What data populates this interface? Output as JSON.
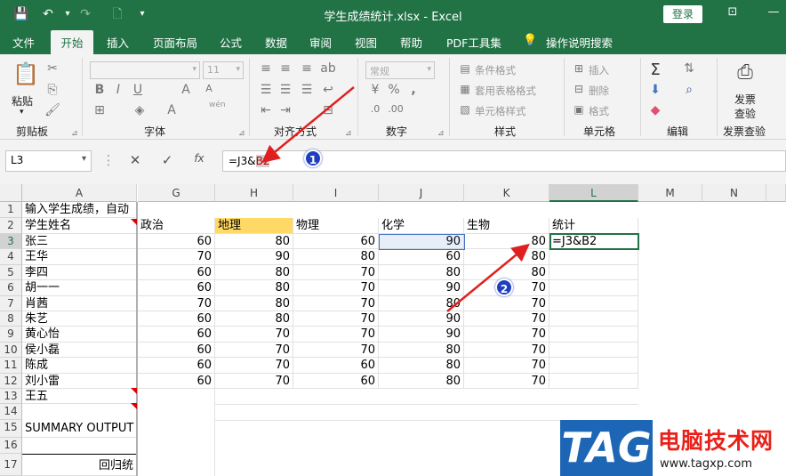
{
  "titlebar": {
    "title": "学生成绩统计.xlsx  -  Excel",
    "login_label": "登录",
    "qat_icons": [
      "save-icon",
      "undo-icon",
      "redo-icon",
      "print-preview-icon",
      "customize-icon"
    ],
    "window_controls": [
      "ribbon-display-icon",
      "minimize-icon",
      "maximize-icon",
      "close-icon"
    ],
    "accent": "#217346"
  },
  "tabs": [
    "文件",
    "开始",
    "插入",
    "页面布局",
    "公式",
    "数据",
    "审阅",
    "视图",
    "帮助",
    "PDF工具集",
    "操作说明搜索"
  ],
  "active_tab": "开始",
  "ribbon": {
    "clipboard": {
      "paste_label": "粘贴",
      "group_label": "剪贴板"
    },
    "font": {
      "font_name": "",
      "font_size": "11",
      "group_label": "字体",
      "wen_label": "wén"
    },
    "alignment": {
      "group_label": "对齐方式"
    },
    "number": {
      "format": "常规",
      "group_label": "数字"
    },
    "styles": {
      "items": [
        "条件格式",
        "套用表格格式",
        "单元格样式"
      ],
      "group_label": "样式"
    },
    "cells": {
      "items": [
        "插入",
        "删除",
        "格式"
      ],
      "group_label": "单元格"
    },
    "editing": {
      "group_label": "编辑"
    },
    "check": {
      "button_label": "发票查验",
      "button_line1": "发票",
      "button_line2": "查验",
      "group_label": "发票查验"
    }
  },
  "formula_bar": {
    "name_box": "L3",
    "fx_label": "fx",
    "formula_prefix": "=J3&",
    "formula_ref": "B2"
  },
  "sheet": {
    "columns": [
      "A",
      "G",
      "H",
      "I",
      "J",
      "K",
      "L",
      "M",
      "N"
    ],
    "selected_column": "L",
    "rows": [
      "1",
      "2",
      "3",
      "4",
      "5",
      "6",
      "7",
      "8",
      "9",
      "10",
      "11",
      "12",
      "13",
      "14",
      "15",
      "16",
      "17"
    ],
    "selected_row": "3",
    "a1": "输入学生成绩，自动",
    "headers": [
      "学生姓名",
      "政治",
      "地理",
      "物理",
      "化学",
      "生物",
      "统计"
    ],
    "students": [
      {
        "name": "张三",
        "g": "60",
        "h": "80",
        "i": "60",
        "j": "90",
        "k": "80",
        "l": "=J3&B2"
      },
      {
        "name": "王华",
        "g": "70",
        "h": "90",
        "i": "80",
        "j": "60",
        "k": "80",
        "l": ""
      },
      {
        "name": "李四",
        "g": "60",
        "h": "80",
        "i": "70",
        "j": "80",
        "k": "80",
        "l": ""
      },
      {
        "name": "胡一一",
        "g": "60",
        "h": "80",
        "i": "70",
        "j": "90",
        "k": "70",
        "l": ""
      },
      {
        "name": "肖茜",
        "g": "70",
        "h": "80",
        "i": "70",
        "j": "80",
        "k": "70",
        "l": ""
      },
      {
        "name": "朱艺",
        "g": "60",
        "h": "80",
        "i": "70",
        "j": "90",
        "k": "70",
        "l": ""
      },
      {
        "name": "黄心怡",
        "g": "60",
        "h": "70",
        "i": "70",
        "j": "90",
        "k": "70",
        "l": ""
      },
      {
        "name": "侯小磊",
        "g": "60",
        "h": "70",
        "i": "70",
        "j": "80",
        "k": "70",
        "l": ""
      },
      {
        "name": "陈成",
        "g": "60",
        "h": "70",
        "i": "60",
        "j": "80",
        "k": "70",
        "l": ""
      },
      {
        "name": "刘小雷",
        "g": "60",
        "h": "70",
        "i": "60",
        "j": "80",
        "k": "70",
        "l": ""
      }
    ],
    "a13": "王五",
    "a15": "SUMMARY OUTPUT",
    "a17": "回归统"
  },
  "annotations": {
    "badge1": "1",
    "badge2": "2",
    "arrow_color": "#e02020",
    "badge_color": "#1f3fbf"
  },
  "watermark": {
    "logo": "TAG",
    "name": "电脑技术网",
    "url": "www.tagxp.com"
  }
}
